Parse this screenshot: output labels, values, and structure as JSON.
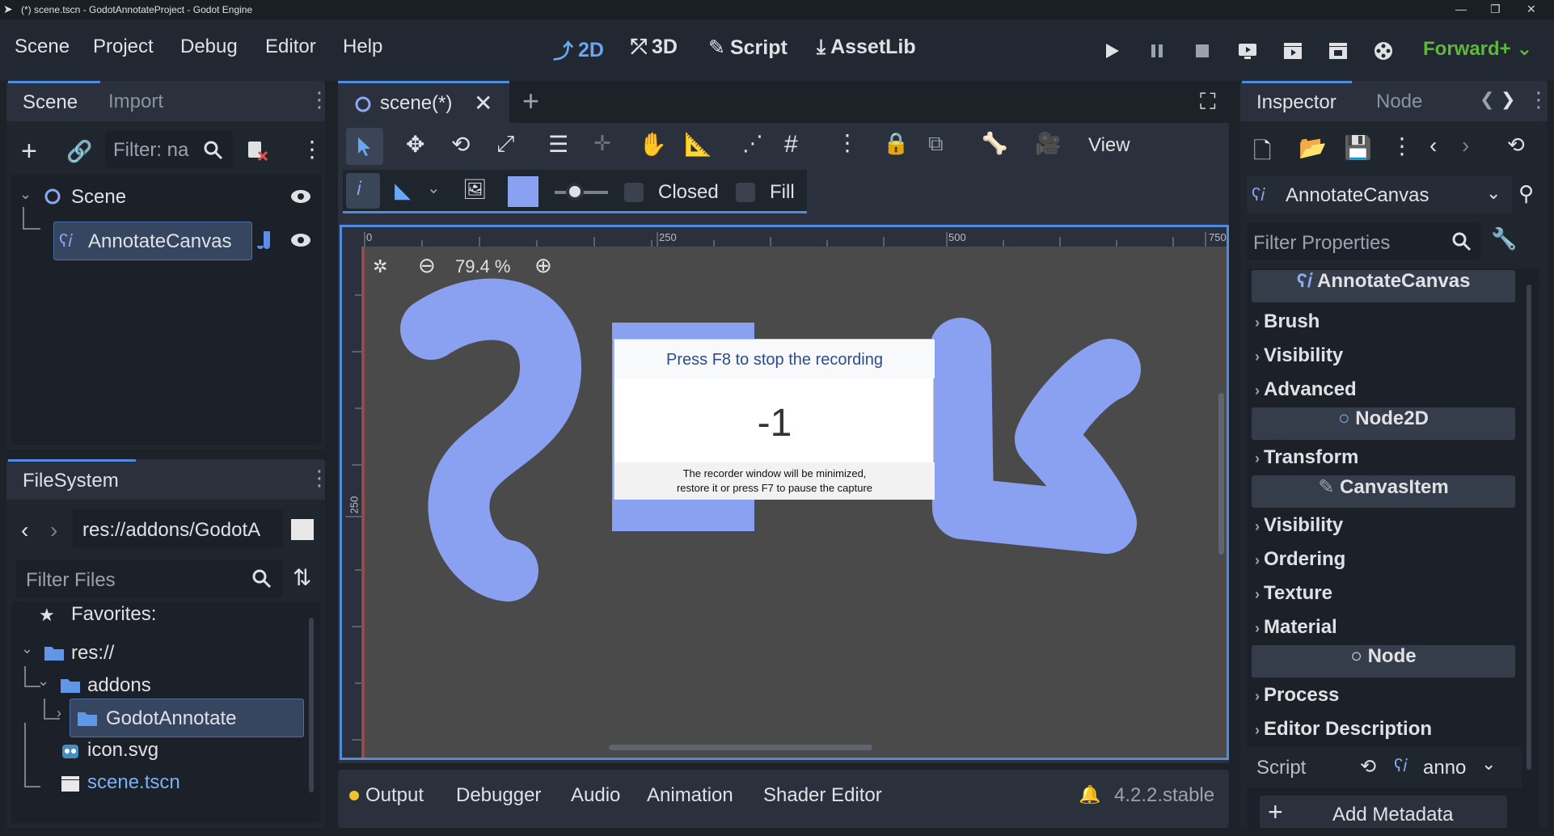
{
  "window": {
    "title": "(*) scene.tscn - GodotAnnotateProject - Godot Engine"
  },
  "menu": [
    "Scene",
    "Project",
    "Debug",
    "Editor",
    "Help"
  ],
  "workspaces": {
    "w2d": "2D",
    "w3d": "3D",
    "script": "Script",
    "assetlib": "AssetLib"
  },
  "renderer": "Forward+",
  "scene_dock": {
    "tabs": [
      "Scene",
      "Import"
    ],
    "filter_placeholder": "Filter: na",
    "tree": [
      {
        "label": "Scene"
      },
      {
        "label": "AnnotateCanvas"
      }
    ]
  },
  "filesystem": {
    "tab": "FileSystem",
    "path": "res://addons/GodotA",
    "filter_placeholder": "Filter Files",
    "items": [
      "Favorites:",
      "res://",
      "addons",
      "GodotAnnotate",
      "icon.svg",
      "scene.tscn"
    ]
  },
  "editor": {
    "tab_label": "scene(*)",
    "view_label": "View",
    "closed_label": "Closed",
    "fill_label": "Fill",
    "zoom": "79.4 %",
    "ruler_ticks": [
      "0",
      "250",
      "500",
      "750"
    ],
    "ruler_v_tick": "250",
    "brush_color": "#8aa0f0"
  },
  "recording": {
    "header": "Press F8 to stop the recording",
    "count": "-1",
    "note_line1": "The recorder window will be minimized,",
    "note_line2": "restore it or press F7 to pause the capture"
  },
  "bottom": {
    "tabs": [
      "Output",
      "Debugger",
      "Audio",
      "Animation",
      "Shader Editor"
    ],
    "version": "4.2.2.stable"
  },
  "inspector": {
    "tabs": [
      "Inspector",
      "Node"
    ],
    "object_name": "AnnotateCanvas",
    "filter_placeholder": "Filter Properties",
    "sections": [
      {
        "kind": "header",
        "label": "AnnotateCanvas"
      },
      {
        "kind": "prop",
        "label": "Brush"
      },
      {
        "kind": "prop",
        "label": "Visibility"
      },
      {
        "kind": "prop",
        "label": "Advanced"
      },
      {
        "kind": "header",
        "label": "Node2D"
      },
      {
        "kind": "prop",
        "label": "Transform"
      },
      {
        "kind": "header",
        "label": "CanvasItem"
      },
      {
        "kind": "prop",
        "label": "Visibility"
      },
      {
        "kind": "prop",
        "label": "Ordering"
      },
      {
        "kind": "prop",
        "label": "Texture"
      },
      {
        "kind": "prop",
        "label": "Material"
      },
      {
        "kind": "header",
        "label": "Node"
      },
      {
        "kind": "prop",
        "label": "Process"
      },
      {
        "kind": "prop",
        "label": "Editor Description"
      }
    ],
    "script_label": "Script",
    "script_value": "anno",
    "add_metadata": "Add Metadata"
  }
}
